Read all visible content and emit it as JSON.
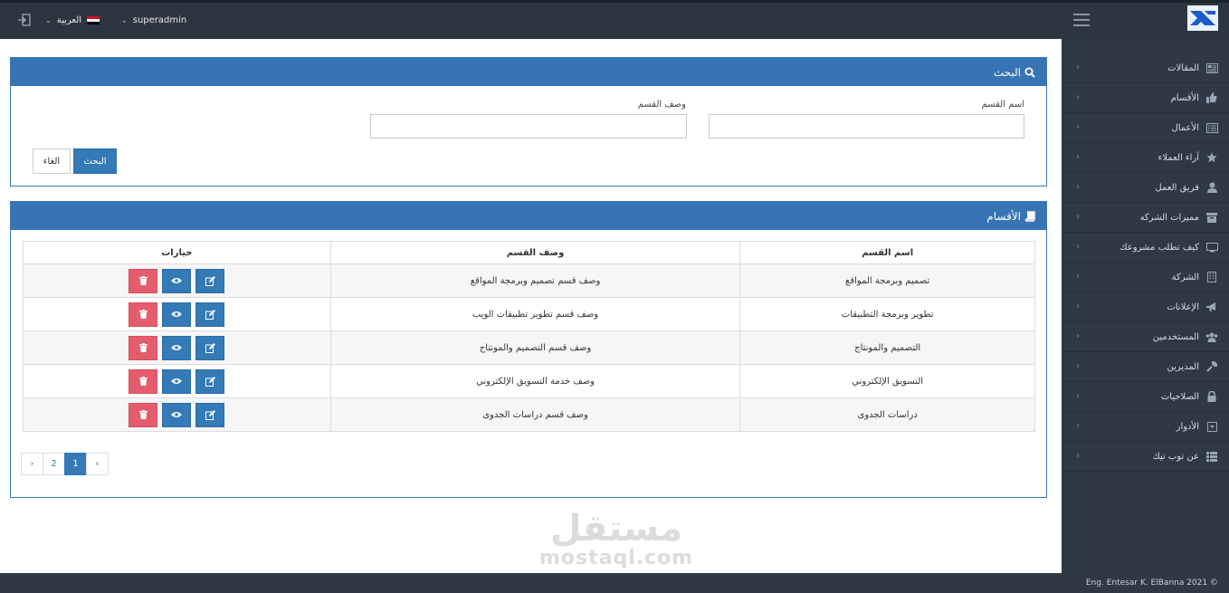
{
  "topbar": {
    "user": "superadmin",
    "language": "العربية"
  },
  "sidebar": {
    "items": [
      {
        "label": "المقالات",
        "icon": "newspaper-icon"
      },
      {
        "label": "الأقسام",
        "icon": "thumbs-up-icon"
      },
      {
        "label": "الأعمال",
        "icon": "list-alt-icon"
      },
      {
        "label": "آراء العملاء",
        "icon": "star-icon"
      },
      {
        "label": "فريق العمل",
        "icon": "user-icon"
      },
      {
        "label": "مميزات الشركه",
        "icon": "archive-icon"
      },
      {
        "label": "كيف تطلب مشروعك",
        "icon": "desktop-icon"
      },
      {
        "label": "الشركة",
        "icon": "building-icon"
      },
      {
        "label": "الإعلانات",
        "icon": "bullhorn-icon"
      },
      {
        "label": "المستخدمين",
        "icon": "users-icon"
      },
      {
        "label": "المديرين",
        "icon": "wrench-icon"
      },
      {
        "label": "الصلاحيات",
        "icon": "lock-icon"
      },
      {
        "label": "الأدوار",
        "icon": "square-caret-icon"
      },
      {
        "label": "عن توب تيك",
        "icon": "list-icon"
      }
    ]
  },
  "search": {
    "title": "البحث",
    "name_label": "اسم القسم",
    "desc_label": "وصف القسم",
    "search_button": "البحث",
    "cancel_button": "الغاء"
  },
  "sections": {
    "title": "الأقسام",
    "columns": {
      "name": "اسم القسم",
      "desc": "وصف القسم",
      "options": "خيارات"
    },
    "rows": [
      {
        "name": "تصميم وبرمجة المواقع",
        "desc": "وصف قسم تصميم وبرمجة المواقع"
      },
      {
        "name": "تطوير وبرمجة التطبيقات",
        "desc": "وصف قسم تطوير تطبيقات الويب"
      },
      {
        "name": "التصميم والمونتاج",
        "desc": "وصف قسم التصميم والمونتاج"
      },
      {
        "name": "التسويق الإلكتروني",
        "desc": "وصف خدمة التسويق الإلكتروني"
      },
      {
        "name": "دراسات الجدوى",
        "desc": "وصف قسم دراسات الجدوى"
      }
    ]
  },
  "pagination": {
    "prev": "‹",
    "pages": [
      "1",
      "2"
    ],
    "next": "›",
    "active": "1"
  },
  "watermark": {
    "arabic": "مستقل",
    "latin": "mostaql.com"
  },
  "footer": {
    "text": "Eng. Entesar K. ElBanna 2021 ©"
  },
  "colors": {
    "primary": "#337ab7",
    "danger": "#e45d6c",
    "dark": "#2d3540"
  }
}
